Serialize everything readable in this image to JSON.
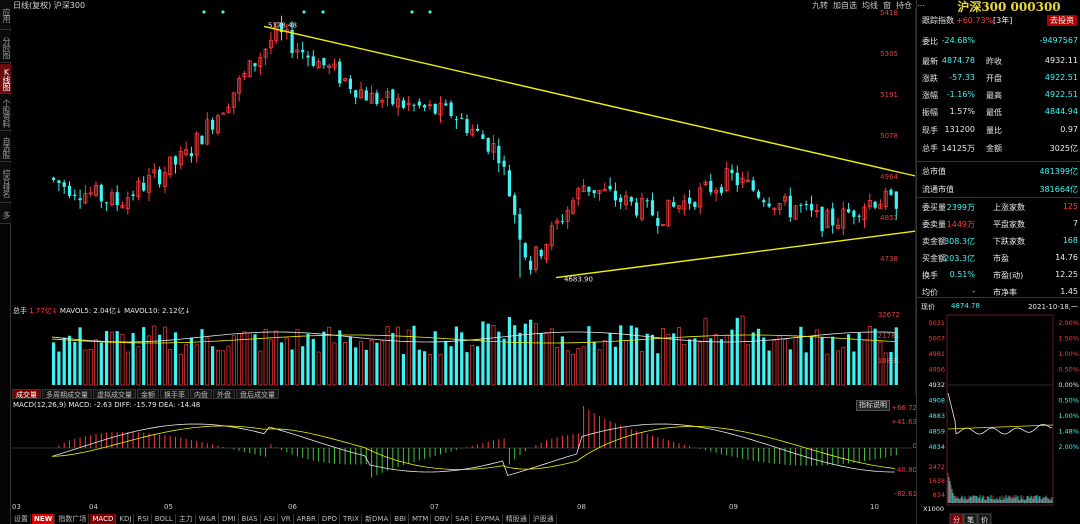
{
  "left_nav": [
    "应用",
    "分时图",
    "K线图",
    "个股资料",
    "自选股",
    "综合排名",
    "多"
  ],
  "top_title": "日线(复权)  沪深300",
  "top_tools": [
    "九转",
    "加自选",
    "均线",
    "窗",
    "持仓",
    "⋯"
  ],
  "stock_title": "沪深300 000300",
  "tracking": {
    "label": "跟踪指数",
    "value": "+60.73%",
    "period": "[3年]",
    "button": "去投资"
  },
  "quote_rows": [
    {
      "l": "委比",
      "v": "-24.68%",
      "l2": "",
      "v2": "-9497567"
    },
    {
      "l": "最新",
      "v": "4874.78",
      "l2": "昨收",
      "v2": "4932.11"
    },
    {
      "l": "涨跌",
      "v": "-57.33",
      "l2": "开盘",
      "v2": "4922.51"
    },
    {
      "l": "涨幅",
      "v": "-1.16%",
      "l2": "最高",
      "v2": "4922.51"
    },
    {
      "l": "振幅",
      "v": "1.57%",
      "l2": "最低",
      "v2": "4844.94"
    },
    {
      "l": "现手",
      "v": "131200",
      "l2": "量比",
      "v2": "0.97"
    },
    {
      "l": "总手",
      "v": "14125万",
      "l2": "金额",
      "v2": "3025亿"
    }
  ],
  "cap_rows": [
    {
      "l": "总市值",
      "v": "481399亿"
    },
    {
      "l": "流通市值",
      "v": "381664亿"
    }
  ],
  "stat_rows": [
    {
      "l": "委买量",
      "v": "2399万",
      "l2": "上涨家数",
      "v2": "125"
    },
    {
      "l": "委卖量",
      "v": "1449万",
      "l2": "平盘家数",
      "v2": "7"
    },
    {
      "l": "卖金额",
      "v": "308.3亿",
      "l2": "下跌家数",
      "v2": "168"
    },
    {
      "l": "买金额",
      "v": "203.3亿",
      "l2": "市盈",
      "v2": "14.76"
    },
    {
      "l": "换手",
      "v": "0.51%",
      "l2": "市盈(动)",
      "v2": "12.25"
    },
    {
      "l": "均价",
      "v": "-",
      "l2": "市净率",
      "v2": "1.45"
    }
  ],
  "intraday": {
    "label": "现价",
    "price": "4874.78",
    "date": "2021-10-18,一",
    "left_ticks": [
      "5031",
      "5007",
      "4981",
      "4956",
      "4932",
      "4908",
      "4883",
      "4859",
      "4834"
    ],
    "right_ticks": [
      "2.00%",
      "1.50%",
      "1.00%",
      "0.50%",
      "0.00%",
      "0.50%",
      "1.00%",
      "1.48%",
      "2.00%"
    ],
    "vol_ticks": [
      "2472",
      "1638",
      "834"
    ],
    "vol_scale": "X1000",
    "tabs": [
      "分",
      "笔",
      "价"
    ]
  },
  "main_chart": {
    "y_ticks": [
      "5418",
      "5305",
      "5191",
      "5078",
      "4964",
      "4851",
      "4738"
    ],
    "high_label": "5378.48",
    "low_label": "4683.90"
  },
  "volume": {
    "legend": {
      "a": "总手",
      "av": "1.77亿",
      "b": "MAVOL5:",
      "bv": "2.04亿",
      "c": "MAVOL10:",
      "cv": "2.12亿"
    },
    "y_ticks": [
      "32672",
      "21781",
      "10891"
    ]
  },
  "ind_tabs": [
    "成交量",
    "多周期成交量",
    "虚拟成交量",
    "金额",
    "换手率",
    "内盘",
    "外盘",
    "盘后成交量"
  ],
  "macd": {
    "legend": "MACD(12,26,9)  MACD: -2.63  DIFF: -15.79  DEA: -14.48",
    "button": "指标说明",
    "y_ticks": [
      "+66.72",
      "+41.63",
      "0",
      "-40.80",
      "-82.61"
    ]
  },
  "x_ticks": [
    "03",
    "04",
    "05",
    "06",
    "07",
    "08",
    "09",
    "10"
  ],
  "bottom_bar": [
    "设置",
    "NEW",
    "指数广场",
    "MACD",
    "KDJ",
    "RSI",
    "BOLL",
    "主力",
    "W&R",
    "DMI",
    "BIAS",
    "ASI",
    "VR",
    "ARBR",
    "DPO",
    "TRIX",
    "新DMA",
    "BBI",
    "MTM",
    "OBV",
    "SAR",
    "EXPMA",
    "精股通",
    "沪股通"
  ],
  "colors": {
    "up": "#ff3b3b",
    "down": "#3ef3f3",
    "trend": "#f0f000",
    "axis": "#e04040"
  }
}
